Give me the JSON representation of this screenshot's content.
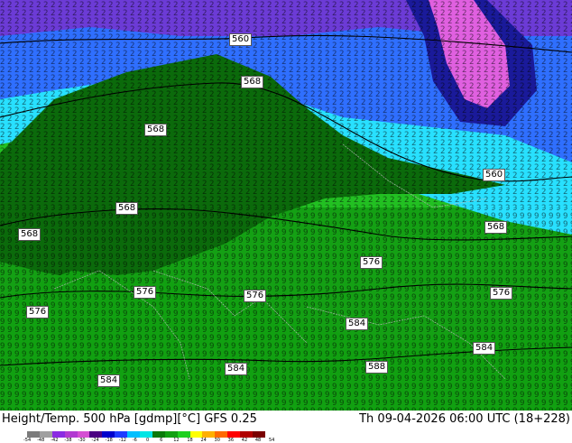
{
  "footer": {
    "title_left": "Height/Temp. 500 hPa [gdmp][°C] GFS 0.25",
    "title_right": "Th 09-04-2026 06:00 UTC (18+228)"
  },
  "colorbar": {
    "ticks": [
      "-54",
      "-48",
      "-42",
      "-38",
      "-30",
      "-24",
      "-18",
      "-12",
      "-6",
      "0",
      "6",
      "12",
      "18",
      "24",
      "30",
      "36",
      "42",
      "48",
      "54"
    ],
    "colors": [
      "#7b7b7b",
      "#a0a0a0",
      "#8a2be2",
      "#b23ad1",
      "#d54fd3",
      "#4b0082",
      "#0000cd",
      "#1e3cff",
      "#00bfff",
      "#00e5e5",
      "#0a7a0a",
      "#11a011",
      "#1ed01e",
      "#ffff00",
      "#ffb000",
      "#ff6a00",
      "#ff0000",
      "#b00000",
      "#7a0000"
    ]
  },
  "contour_labels": [
    "560",
    "568",
    "568",
    "568",
    "560",
    "576",
    "568",
    "576",
    "576",
    "576",
    "576",
    "584",
    "584",
    "584",
    "588",
    "584",
    "576",
    "568"
  ],
  "map_colors": {
    "purple": "#6c3bd6",
    "blue": "#2f6fff",
    "cyan": "#28e0ff",
    "dark_green": "#0b6a0b",
    "green": "#14a014",
    "bright_green": "#22c022",
    "pink": "#e060e0",
    "navy": "#1a1a9a"
  }
}
